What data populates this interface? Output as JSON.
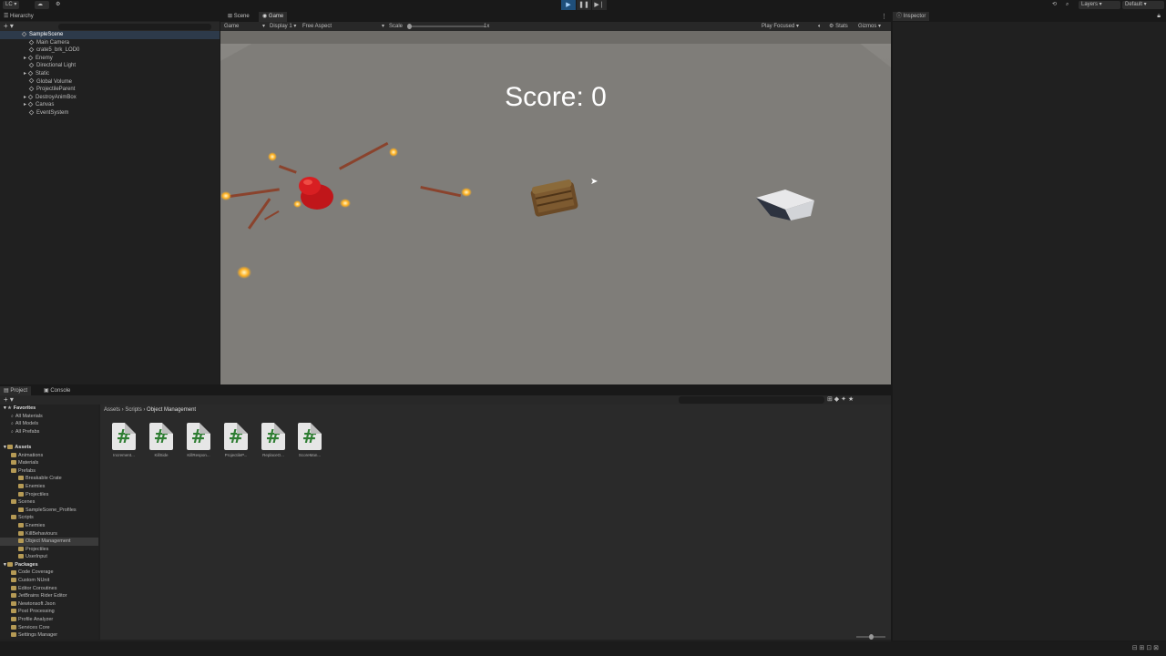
{
  "topbar": {
    "account": "LC",
    "layers": "Layers",
    "layout": "Default"
  },
  "hierarchy": {
    "tab": "Hierarchy",
    "scene": "SampleScene",
    "items": [
      "Main Camera",
      "crate5_brk_LOD0",
      "Enemy",
      "Directional Light",
      "Static",
      "Global Volume",
      "ProjectileParent",
      "DestroyAnimBox",
      "Canvas",
      "EventSystem"
    ]
  },
  "game": {
    "tabs": [
      "Scene",
      "Game"
    ],
    "mode": "Game",
    "display": "Display 1",
    "aspect": "Free Aspect",
    "scale_label": "Scale",
    "scale_value": "1x",
    "play_focused": "Play Focused",
    "stats": "Stats",
    "gizmos": "Gizmos",
    "score": "Score: 0"
  },
  "inspector": {
    "tab": "Inspector"
  },
  "project": {
    "tabs": [
      "Project",
      "Console"
    ],
    "breadcrumb": [
      "Assets",
      "Scripts",
      "Object Management"
    ],
    "tree": [
      {
        "label": "Favorites",
        "type": "star",
        "indent": 0,
        "bold": true
      },
      {
        "label": "All Materials",
        "type": "search",
        "indent": 1
      },
      {
        "label": "All Models",
        "type": "search",
        "indent": 1
      },
      {
        "label": "All Prefabs",
        "type": "search",
        "indent": 1
      },
      {
        "label": "",
        "type": "spacer",
        "indent": 0
      },
      {
        "label": "Assets",
        "type": "folder",
        "indent": 0,
        "bold": true
      },
      {
        "label": "Animations",
        "type": "folder",
        "indent": 1
      },
      {
        "label": "Materials",
        "type": "folder",
        "indent": 1
      },
      {
        "label": "Prefabs",
        "type": "folder",
        "indent": 1
      },
      {
        "label": "Breakable Crate",
        "type": "folder",
        "indent": 2
      },
      {
        "label": "Enemies",
        "type": "folder",
        "indent": 2
      },
      {
        "label": "Projectiles",
        "type": "folder",
        "indent": 2
      },
      {
        "label": "Scenes",
        "type": "folder",
        "indent": 1
      },
      {
        "label": "SampleScene_Profiles",
        "type": "folder",
        "indent": 2
      },
      {
        "label": "Scripts",
        "type": "folder",
        "indent": 1
      },
      {
        "label": "Enemies",
        "type": "folder",
        "indent": 2
      },
      {
        "label": "KillBehaviours",
        "type": "folder",
        "indent": 2
      },
      {
        "label": "Object Management",
        "type": "folder",
        "indent": 2,
        "selected": true
      },
      {
        "label": "Projectiles",
        "type": "folder",
        "indent": 2
      },
      {
        "label": "UserInput",
        "type": "folder",
        "indent": 2
      },
      {
        "label": "Packages",
        "type": "folder",
        "indent": 0,
        "bold": true
      },
      {
        "label": "Code Coverage",
        "type": "folder",
        "indent": 1
      },
      {
        "label": "Custom NUnit",
        "type": "folder",
        "indent": 1
      },
      {
        "label": "Editor Coroutines",
        "type": "folder",
        "indent": 1
      },
      {
        "label": "JetBrains Rider Editor",
        "type": "folder",
        "indent": 1
      },
      {
        "label": "Newtonsoft Json",
        "type": "folder",
        "indent": 1
      },
      {
        "label": "Post Processing",
        "type": "folder",
        "indent": 1
      },
      {
        "label": "Profile Analyzer",
        "type": "folder",
        "indent": 1
      },
      {
        "label": "Services Core",
        "type": "folder",
        "indent": 1
      },
      {
        "label": "Settings Manager",
        "type": "folder",
        "indent": 1
      }
    ],
    "assets": [
      "Increment...",
      "KillSide",
      "KillRespon...",
      "ProjectileP...",
      "ReplaceO...",
      "ScoreMan..."
    ]
  }
}
